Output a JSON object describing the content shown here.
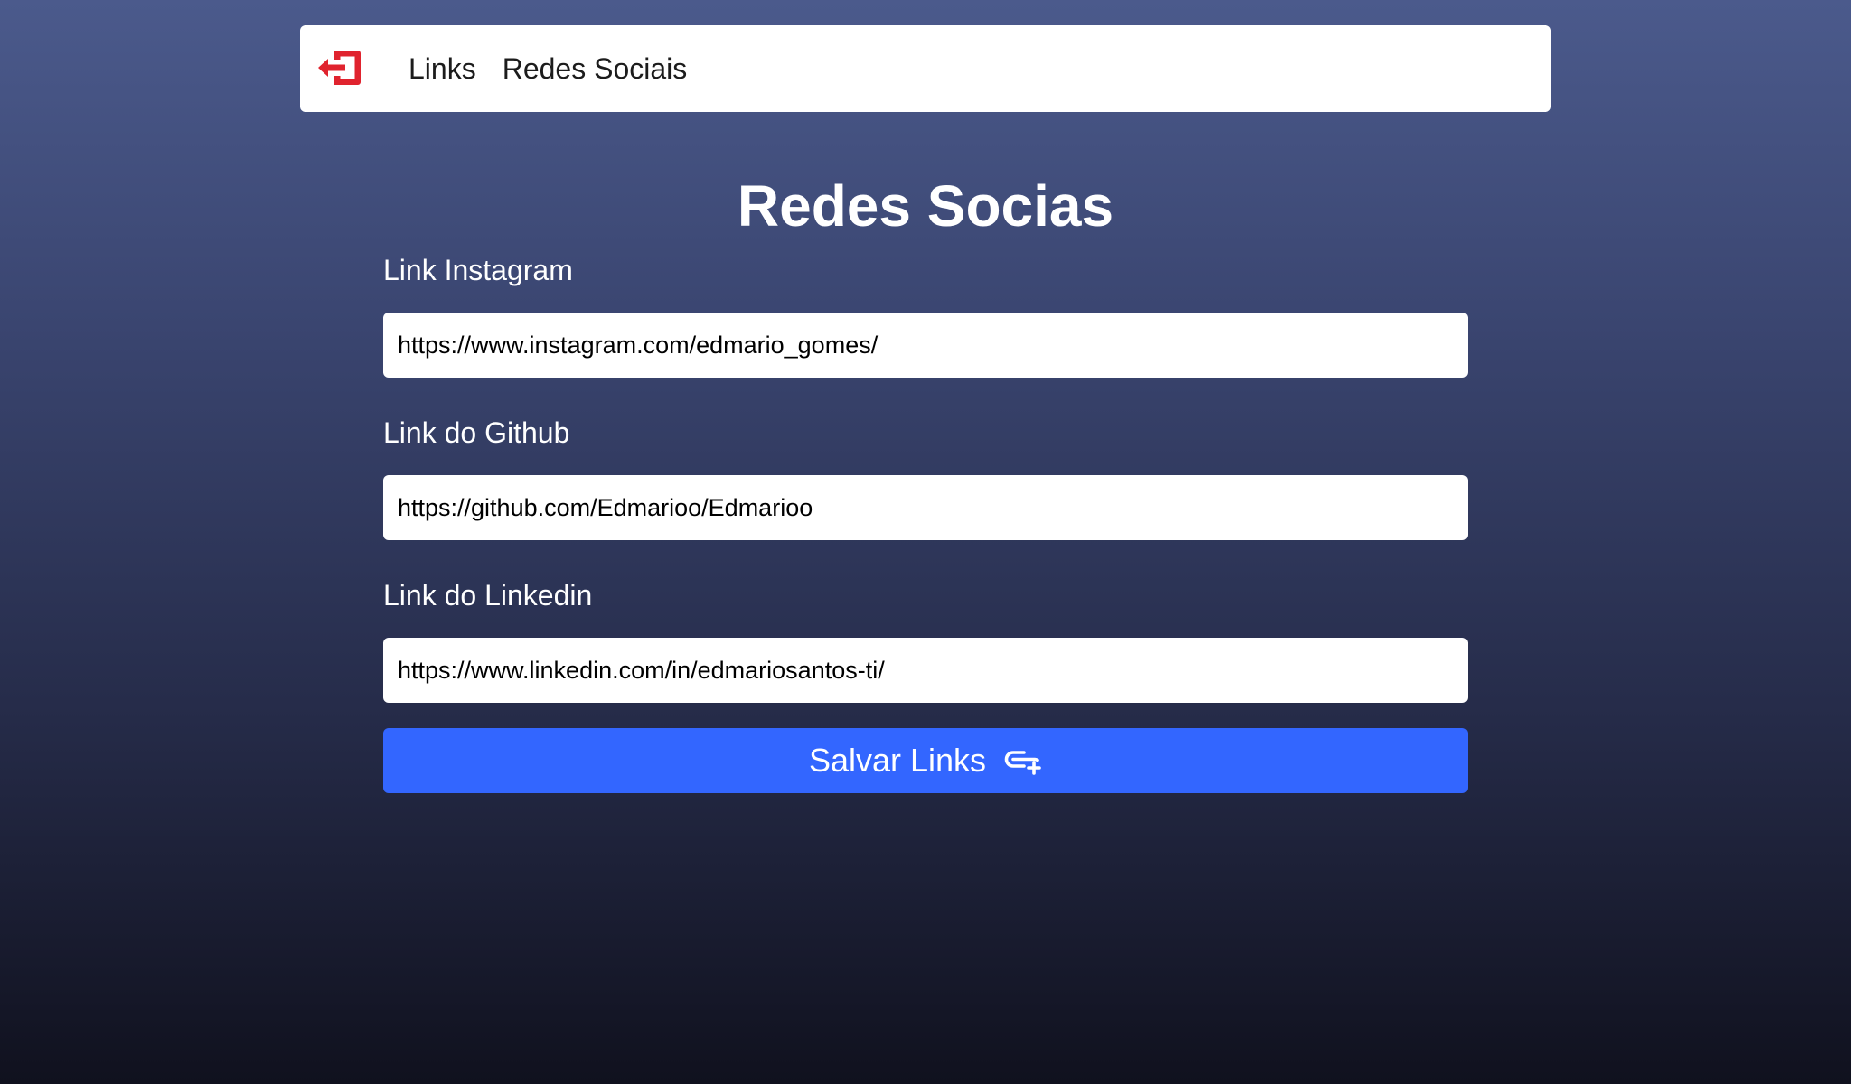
{
  "header": {
    "logout_icon": "logout-icon",
    "logout_color": "#e0232e",
    "nav": [
      {
        "label": "Links"
      },
      {
        "label": "Redes Sociais"
      }
    ]
  },
  "main": {
    "title": "Redes Socias",
    "fields": [
      {
        "label": "Link Instagram",
        "value": "https://www.instagram.com/edmario_gomes/"
      },
      {
        "label": "Link do Github",
        "value": "https://github.com/Edmarioo/Edmarioo"
      },
      {
        "label": "Link do Linkedin",
        "value": "https://www.linkedin.com/in/edmariosantos-ti/"
      }
    ],
    "save_button": {
      "label": "Salvar Links",
      "icon": "link-add-icon",
      "color": "#3366ff"
    }
  }
}
